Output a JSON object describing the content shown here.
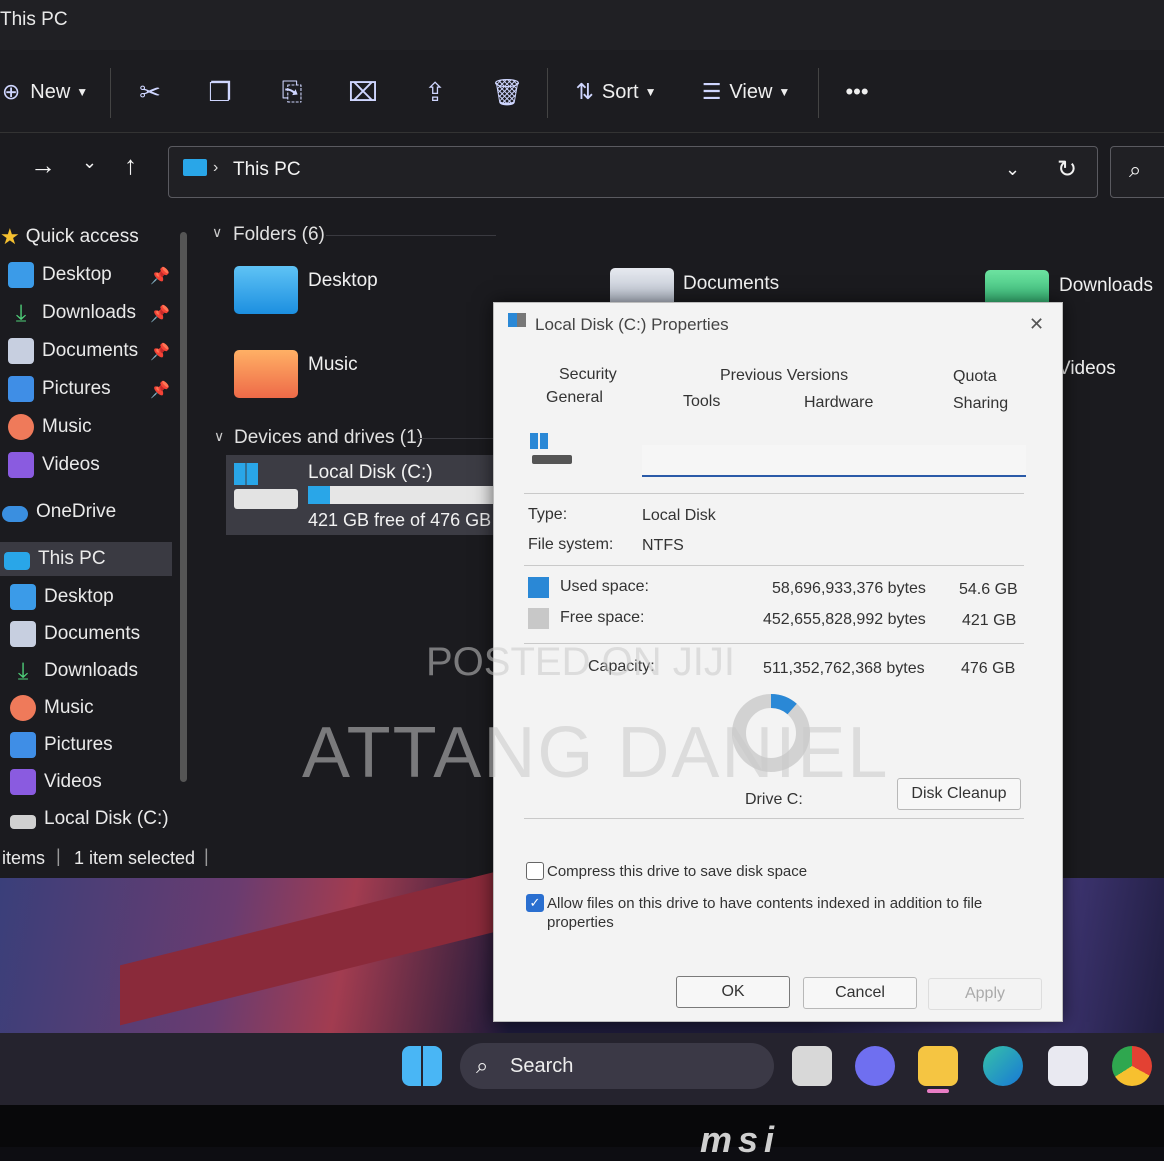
{
  "window": {
    "title": "This PC"
  },
  "toolbar": {
    "new_label": "New",
    "sort_label": "Sort",
    "view_label": "View",
    "more_label": "•••"
  },
  "address": {
    "path": "This PC"
  },
  "sidebar": {
    "quick_access": "Quick access",
    "pinned": [
      "Desktop",
      "Downloads",
      "Documents",
      "Pictures"
    ],
    "quick_other": [
      "Music",
      "Videos"
    ],
    "onedrive": "OneDrive",
    "this_pc": "This PC",
    "this_pc_items": [
      "Desktop",
      "Documents",
      "Downloads",
      "Music",
      "Pictures",
      "Videos",
      "Local Disk (C:)"
    ]
  },
  "main": {
    "folders_header": "Folders (6)",
    "folders": [
      "Desktop",
      "Documents",
      "Downloads",
      "Music",
      "Videos"
    ],
    "devices_header": "Devices and drives (1)",
    "drive": {
      "name": "Local Disk (C:)",
      "free_text": "421 GB free of 476 GB",
      "used_fraction": 0.115
    }
  },
  "status": {
    "items": "items",
    "selected": "1 item selected"
  },
  "dialog": {
    "title": "Local Disk (C:) Properties",
    "close": "✕",
    "tabs_row1": [
      "Security",
      "Previous Versions",
      "Quota"
    ],
    "tabs_row2": [
      "General",
      "Tools",
      "Hardware",
      "Sharing"
    ],
    "type_label": "Type:",
    "type_value": "Local Disk",
    "fs_label": "File system:",
    "fs_value": "NTFS",
    "used_label": "Used space:",
    "used_bytes": "58,696,933,376 bytes",
    "used_gb": "54.6 GB",
    "free_label": "Free space:",
    "free_bytes": "452,655,828,992 bytes",
    "free_gb": "421 GB",
    "cap_label": "Capacity:",
    "cap_bytes": "511,352,762,368 bytes",
    "cap_gb": "476 GB",
    "drive_label": "Drive C:",
    "cleanup": "Disk Cleanup",
    "compress_label": "Compress this drive to save disk space",
    "compress_checked": false,
    "index_label": "Allow files on this drive to have contents indexed in addition to file properties",
    "index_checked": true,
    "ok": "OK",
    "cancel": "Cancel",
    "apply": "Apply",
    "colors": {
      "used": "#2a88d6",
      "free": "#c8c8c8"
    }
  },
  "taskbar": {
    "search": "Search"
  },
  "watermark": {
    "line1": "POSTED ON JIJI",
    "line2": "ATTANG DANIEL"
  },
  "brand": "msi"
}
